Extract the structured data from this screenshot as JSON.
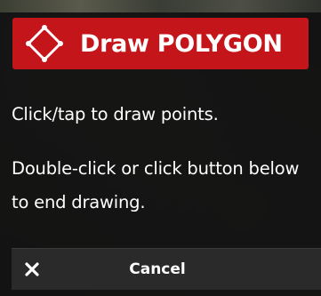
{
  "header": {
    "title": "Draw POLYGON",
    "icon": "polygon-icon",
    "background_color": "#c4151b"
  },
  "instructions": {
    "line1": "Click/tap to draw points.",
    "line2": "Double-click or click button below to end drawing."
  },
  "actions": {
    "cancel_label": "Cancel",
    "cancel_icon": "close-icon"
  }
}
